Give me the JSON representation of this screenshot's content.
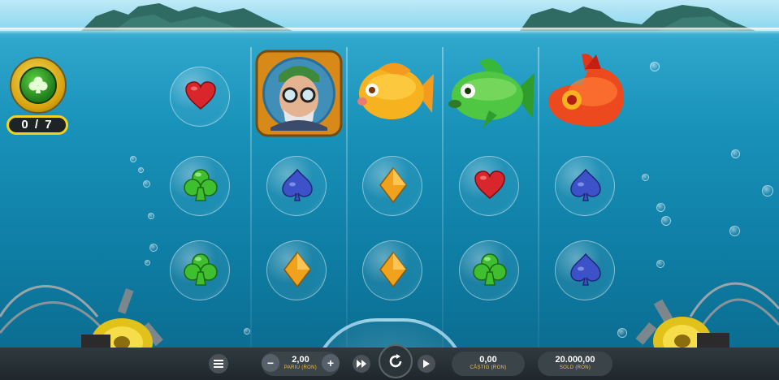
{
  "game": {
    "collect_counter": "0 / 7",
    "collect_symbol": "club-icon"
  },
  "reels": [
    [
      "heart",
      "club",
      "club"
    ],
    [
      "diver",
      "spade",
      "diamond"
    ],
    [
      "yellow-fish",
      "diamond",
      "diamond"
    ],
    [
      "green-fish",
      "heart",
      "club"
    ],
    [
      "red-fish",
      "spade",
      "spade"
    ]
  ],
  "colors": {
    "heart": "#d8262c",
    "club": "#3fbf2f",
    "spade": "#3d52c9",
    "diamond": "#f0a21c",
    "accent": "#f0c24b"
  },
  "controls": {
    "menu_icon": "menu-icon",
    "bet_value": "2,00",
    "bet_label": "PARIU (RON)",
    "minus": "−",
    "plus": "+",
    "win_value": "0,00",
    "win_label": "CÂȘTIG (RON)",
    "balance_value": "20.000,00",
    "balance_label": "SOLD (RON)"
  }
}
